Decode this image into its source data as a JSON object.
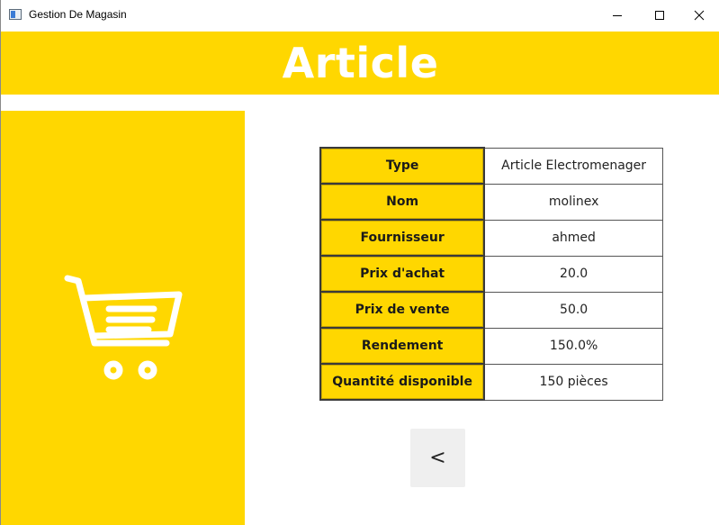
{
  "window": {
    "title": "Gestion De Magasin",
    "controls": {
      "minimize": "minimize-icon",
      "maximize": "maximize-icon",
      "close": "close-icon"
    }
  },
  "header": {
    "title": "Article"
  },
  "sidebar": {
    "icon": "shopping-cart-icon"
  },
  "article": {
    "rows": [
      {
        "label": "Type",
        "value": "Article Electromenager"
      },
      {
        "label": "Nom",
        "value": "molinex"
      },
      {
        "label": "Fournisseur",
        "value": "ahmed"
      },
      {
        "label": "Prix d'achat",
        "value": "20.0"
      },
      {
        "label": "Prix de vente",
        "value": "50.0"
      },
      {
        "label": "Rendement",
        "value": "150.0%"
      },
      {
        "label": "Quantité disponible",
        "value": "150 pièces"
      }
    ]
  },
  "actions": {
    "back_label": "<"
  },
  "colors": {
    "accent": "#ffd700",
    "banner_text": "#ffffff",
    "button_bg": "#efefef"
  }
}
